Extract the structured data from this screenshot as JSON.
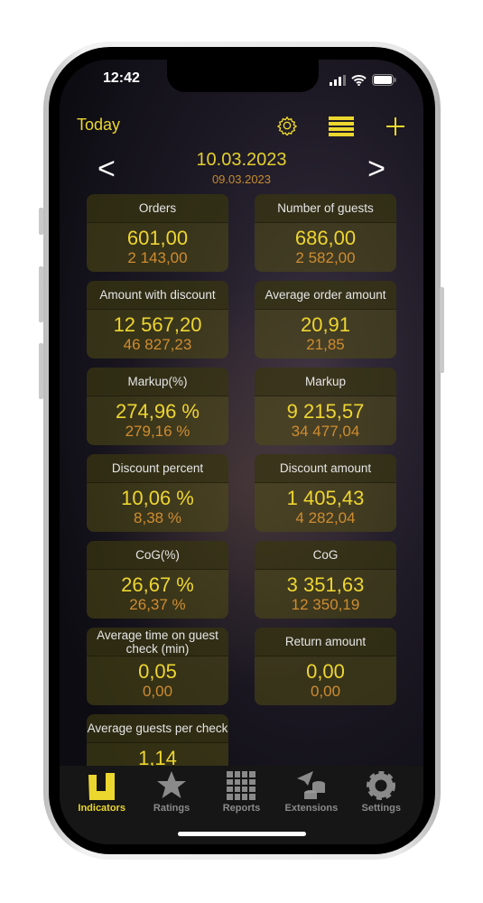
{
  "status_bar": {
    "time": "12:42"
  },
  "header": {
    "today_label": "Today",
    "icons": [
      "gear-icon",
      "list-icon",
      "plus-icon"
    ]
  },
  "dates": {
    "current": "10.03.2023",
    "previous": "09.03.2023",
    "prev_arrow": "<",
    "next_arrow": ">"
  },
  "cards": [
    {
      "title": "Orders",
      "value": "601,00",
      "prev": "2 143,00"
    },
    {
      "title": "Number of guests",
      "value": "686,00",
      "prev": "2 582,00"
    },
    {
      "title": "Amount with discount",
      "value": "12 567,20",
      "prev": "46 827,23"
    },
    {
      "title": "Average order amount",
      "value": "20,91",
      "prev": "21,85"
    },
    {
      "title": "Markup(%)",
      "value": "274,96 %",
      "prev": "279,16 %"
    },
    {
      "title": "Markup",
      "value": "9 215,57",
      "prev": "34 477,04"
    },
    {
      "title": "Discount percent",
      "value": "10,06 %",
      "prev": "8,38 %"
    },
    {
      "title": "Discount amount",
      "value": "1 405,43",
      "prev": "4 282,04"
    },
    {
      "title": "CoG(%)",
      "value": "26,67 %",
      "prev": "26,37 %"
    },
    {
      "title": "CoG",
      "value": "3 351,63",
      "prev": "12 350,19"
    },
    {
      "title": "Average time on guest check (min)",
      "value": "0,05",
      "prev": "0,00"
    },
    {
      "title": "Return amount",
      "value": "0,00",
      "prev": "0,00"
    },
    {
      "title": "Average guests per check",
      "value": "1,14",
      "prev": ""
    }
  ],
  "tabs": [
    {
      "label": "Indicators",
      "icon": "indicators-icon",
      "active": true
    },
    {
      "label": "Ratings",
      "icon": "star-icon"
    },
    {
      "label": "Reports",
      "icon": "grid-icon"
    },
    {
      "label": "Extensions",
      "icon": "extensions-icon"
    },
    {
      "label": "Settings",
      "icon": "gear-icon"
    }
  ],
  "colors": {
    "accent": "#ecd72e",
    "secondary": "#cf8c30",
    "tab_inactive": "#8a8a8a"
  }
}
